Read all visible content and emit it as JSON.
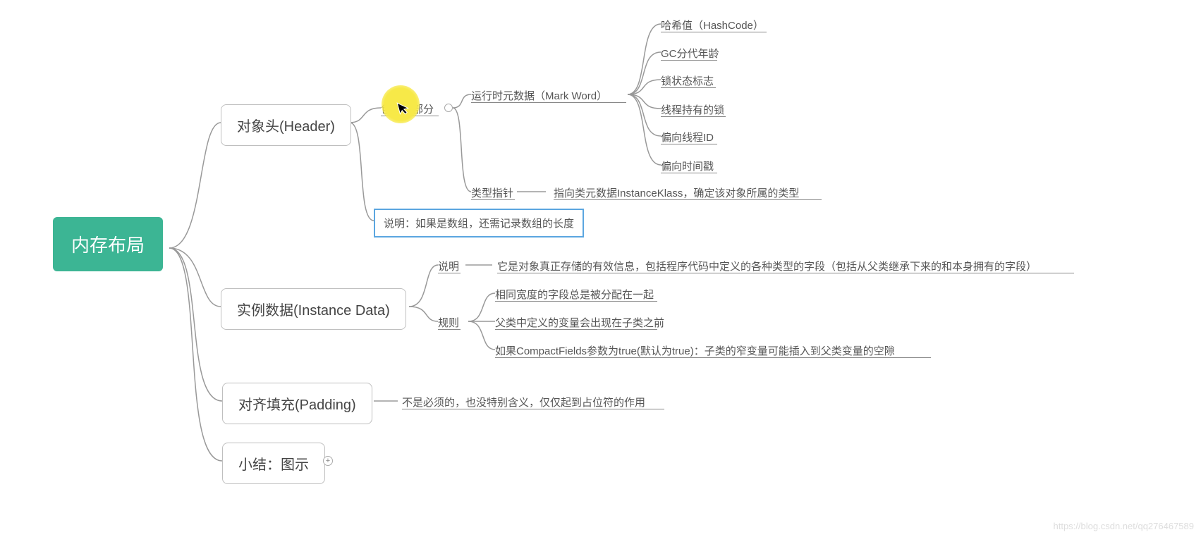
{
  "root": {
    "label": "内存布局"
  },
  "level1": {
    "header": {
      "label": "对象头(Header)"
    },
    "instance": {
      "label": "实例数据(Instance Data)"
    },
    "padding": {
      "label": "对齐填充(Padding)"
    },
    "summary": {
      "label": "小结：图示"
    }
  },
  "header_branch": {
    "two_parts": "包含两部分",
    "note_highlighted": "说明：如果是数组，还需记录数组的长度",
    "mark_word": {
      "label": "运行时元数据（Mark Word）",
      "children": {
        "c1": "哈希值（HashCode）",
        "c2": "GC分代年龄",
        "c3": "锁状态标志",
        "c4": "线程持有的锁",
        "c5": "偏向线程ID",
        "c6": "偏向时间戳"
      }
    },
    "type_ptr": {
      "label": "类型指针",
      "desc": "指向类元数据InstanceKlass，确定该对象所属的类型"
    }
  },
  "instance_branch": {
    "desc_label": "说明",
    "desc_text": "它是对象真正存储的有效信息，包括程序代码中定义的各种类型的字段（包括从父类继承下来的和本身拥有的字段）",
    "rule_label": "规则",
    "rules": {
      "r1": "相同宽度的字段总是被分配在一起",
      "r2": "父类中定义的变量会出现在子类之前",
      "r3": "如果CompactFields参数为true(默认为true)：子类的窄变量可能插入到父类变量的空隙"
    }
  },
  "padding_branch": {
    "desc": "不是必须的，也没特别含义，仅仅起到占位符的作用"
  },
  "watermark": "https://blog.csdn.net/qq276467589"
}
